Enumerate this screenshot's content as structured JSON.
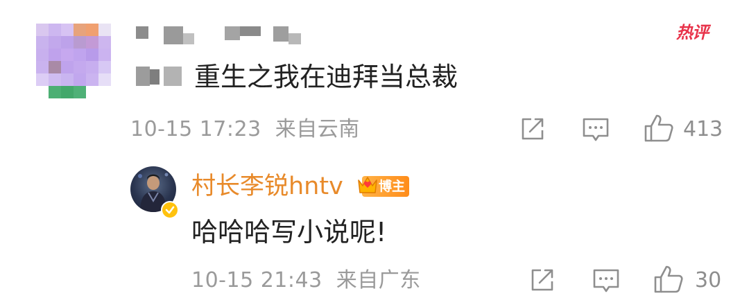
{
  "hot_badge": "热评",
  "comment": {
    "text": "重生之我在迪拜当总裁",
    "time": "10-15 17:23",
    "location": "来自云南",
    "like_count": "413"
  },
  "reply": {
    "author": "村长李锐hntv",
    "badge": "博主",
    "text": "哈哈哈写小说呢!",
    "time": "10-15 21:43",
    "location": "来自广东",
    "like_count": "30"
  },
  "icons": [
    "share-icon",
    "comment-icon",
    "like-icon",
    "crown-icon",
    "verified-icon"
  ],
  "colors": {
    "author": "#e88a2a",
    "hot": "#e8334a",
    "meta": "#9a9a9a",
    "text": "#222222"
  }
}
